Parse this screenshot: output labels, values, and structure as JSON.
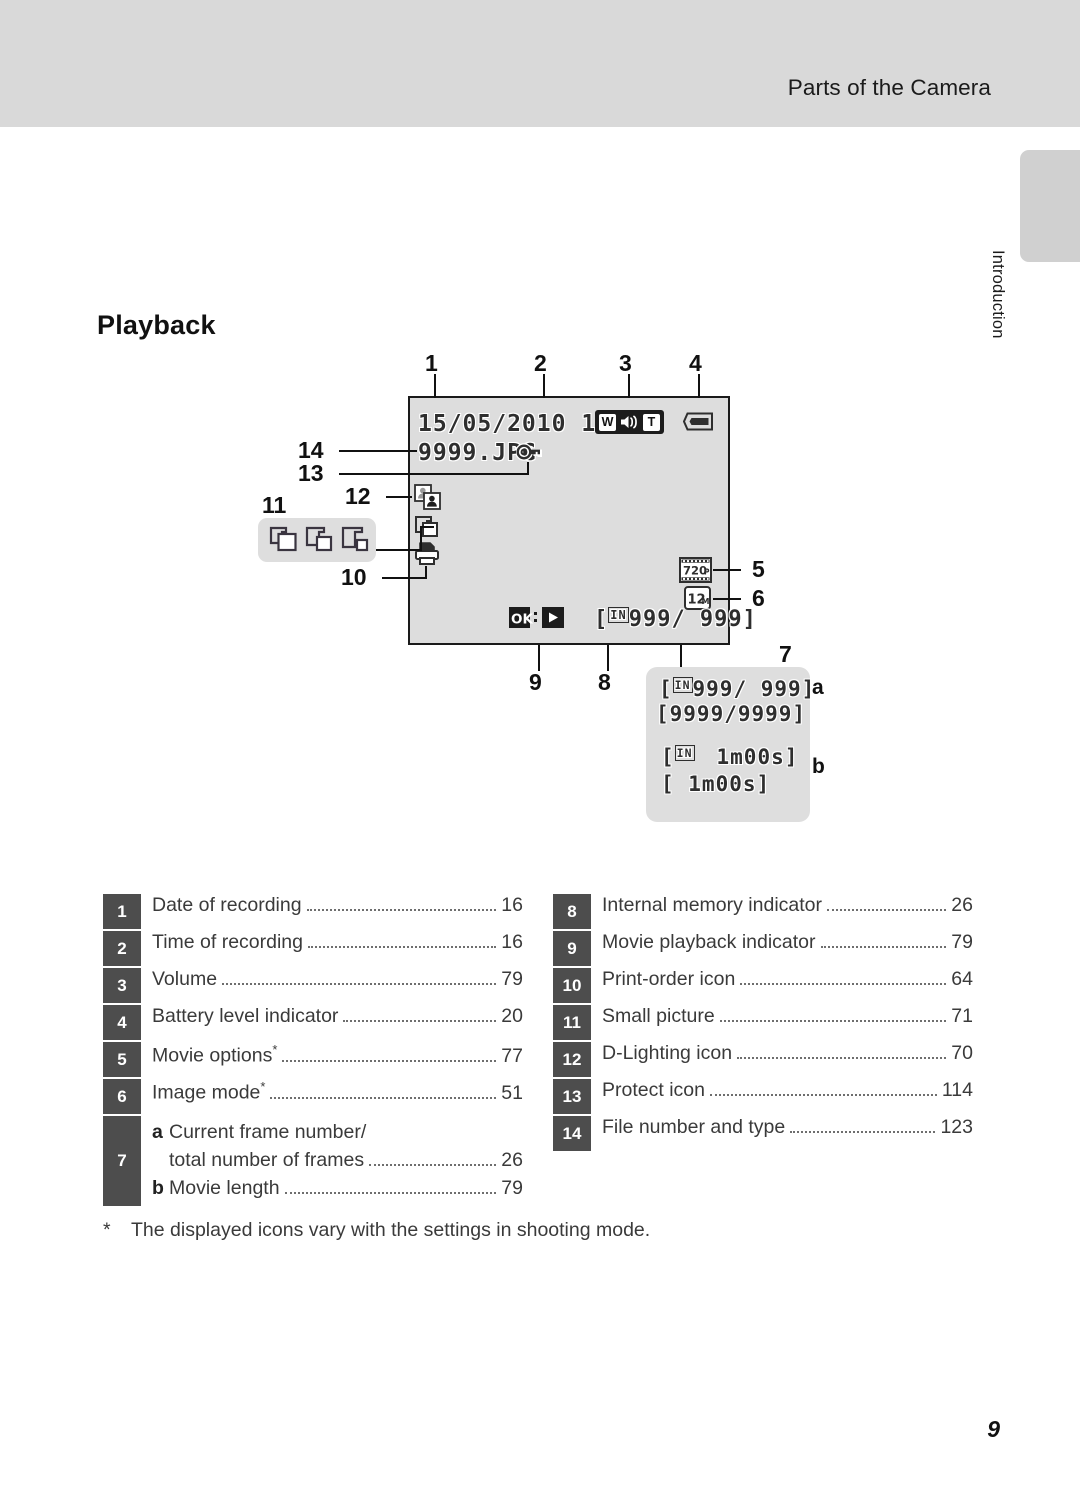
{
  "header": {
    "title": "Parts of the Camera",
    "side_tab_label": "Introduction"
  },
  "section": {
    "heading": "Playback"
  },
  "lcd_display": {
    "date": "15/05/2010",
    "time": "12:00",
    "volume_wide": "W",
    "volume_tele": "T",
    "filename": "9999.JPG",
    "movie_option": "720",
    "movie_option_suffix": "P",
    "image_mode": "12",
    "image_mode_suffix": "M",
    "ok_label": "OK",
    "ok_separator": ":",
    "frame_counter": "[ 999/ 999]",
    "frame_counter_in": "IN"
  },
  "callouts": {
    "n1": "1",
    "n2": "2",
    "n3": "3",
    "n4": "4",
    "n5": "5",
    "n6": "6",
    "n7": "7",
    "n8": "8",
    "n9": "9",
    "n10": "10",
    "n11": "11",
    "n12": "12",
    "n13": "13",
    "n14": "14",
    "sub_a": "a",
    "sub_b": "b"
  },
  "detail_box": {
    "line1_prefix": "[",
    "line1_in": "IN",
    "line1_text": "999/ 999]",
    "line2": "[9999/9999]",
    "line3_prefix": "[",
    "line3_in": "IN",
    "line3_text": "1m00s]",
    "line4": "[      1m00s]"
  },
  "legend": {
    "left": [
      {
        "num": "1",
        "label": "Date of recording",
        "star": false,
        "page": "16"
      },
      {
        "num": "2",
        "label": "Time of recording",
        "star": false,
        "page": "16"
      },
      {
        "num": "3",
        "label": "Volume",
        "star": false,
        "page": "79"
      },
      {
        "num": "4",
        "label": "Battery level indicator",
        "star": false,
        "page": "20"
      },
      {
        "num": "5",
        "label": "Movie options",
        "star": true,
        "page": "77"
      },
      {
        "num": "6",
        "label": "Image mode",
        "star": true,
        "page": "51"
      }
    ],
    "row7": {
      "num": "7",
      "a_marker": "a",
      "a_line1": "Current frame number/",
      "a_line2": "total number of frames",
      "a_page": "26",
      "b_marker": "b",
      "b_label": "Movie length",
      "b_page": "79"
    },
    "right": [
      {
        "num": "8",
        "label": "Internal memory indicator",
        "star": false,
        "page": "26"
      },
      {
        "num": "9",
        "label": "Movie playback indicator",
        "star": false,
        "page": "79"
      },
      {
        "num": "10",
        "label": "Print-order icon",
        "star": false,
        "page": "64"
      },
      {
        "num": "11",
        "label": "Small picture",
        "star": false,
        "page": "71"
      },
      {
        "num": "12",
        "label": "D-Lighting icon",
        "star": false,
        "page": "70"
      },
      {
        "num": "13",
        "label": "Protect icon",
        "star": false,
        "page": "114"
      },
      {
        "num": "14",
        "label": "File number and type",
        "star": false,
        "page": "123"
      }
    ]
  },
  "footnote": {
    "marker": "*",
    "text": "The displayed icons vary with the settings in shooting mode."
  },
  "page_number": "9",
  "colors": {
    "header_band": "#d9d9d9",
    "lcd_fill": "#dddddd",
    "badge": "#4d4d4d",
    "text": "#3a3a3a",
    "side_tab": "#d0d0d0"
  }
}
